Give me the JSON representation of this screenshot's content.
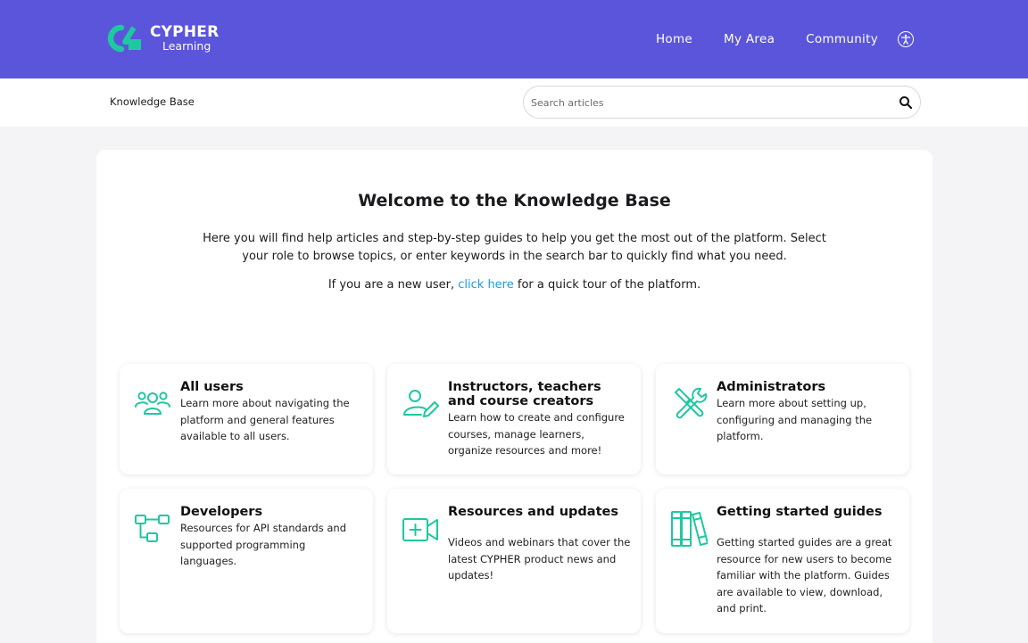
{
  "header": {
    "logo_title": "CYPHER",
    "logo_sub": "Learning",
    "nav": [
      "Home",
      "My Area",
      "Community"
    ],
    "brand_color": "#5b55db",
    "accent_color": "#1ec8a0"
  },
  "subbar": {
    "breadcrumb": "Knowledge Base",
    "search_placeholder": "Search articles"
  },
  "main": {
    "title": "Welcome to the Knowledge Base",
    "intro": "Here you will find help articles and step-by-step guides to help you get the most out of the platform. Select your role to browse topics, or enter keywords in the search bar to quickly find what you need.",
    "newuser_prefix": "If you are a new user, ",
    "newuser_link": "click here",
    "newuser_suffix": " for a quick tour of the platform.",
    "cards": [
      {
        "title": "All users",
        "desc": "Learn more about navigating the platform and general features available to all users.",
        "icon": "users-icon"
      },
      {
        "title": "Instructors, teachers and course creators",
        "desc": "Learn how to create and configure courses, manage learners, organize resources and more!",
        "icon": "instructor-icon"
      },
      {
        "title": "Administrators",
        "desc": "Learn more about setting up, configuring and managing the platform.",
        "icon": "tools-icon"
      },
      {
        "title": "Developers",
        "desc": "Resources for API standards and supported programming languages.",
        "icon": "hierarchy-icon"
      },
      {
        "title": "Resources and updates",
        "desc": "Videos and webinars that cover the latest CYPHER product news and updates!",
        "icon": "video-icon"
      },
      {
        "title": "Getting started guides",
        "desc": "Getting started guides are a great resource for new users to become familiar with the platform. Guides are available to view, download, and print.",
        "icon": "books-icon"
      }
    ]
  }
}
